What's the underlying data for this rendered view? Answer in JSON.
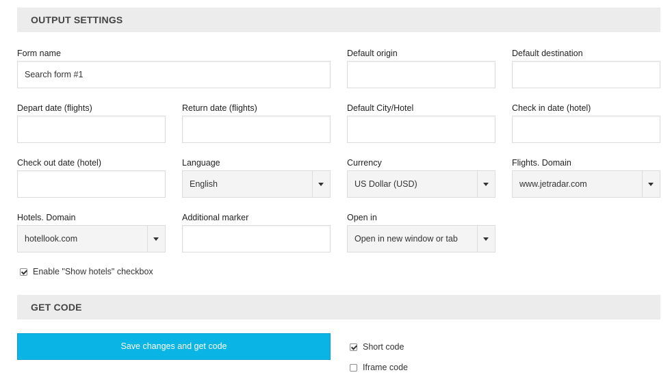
{
  "sections": {
    "output_settings": "OUTPUT SETTINGS",
    "get_code": "GET CODE"
  },
  "fields": {
    "form_name": {
      "label": "Form name",
      "value": "Search form #1"
    },
    "default_origin": {
      "label": "Default origin",
      "value": ""
    },
    "default_destination": {
      "label": "Default destination",
      "value": ""
    },
    "depart_date": {
      "label": "Depart date (flights)",
      "value": ""
    },
    "return_date": {
      "label": "Return date (flights)",
      "value": ""
    },
    "default_city_hotel": {
      "label": "Default City/Hotel",
      "value": ""
    },
    "check_in_date": {
      "label": "Check in date (hotel)",
      "value": ""
    },
    "check_out_date": {
      "label": "Check out date (hotel)",
      "value": ""
    },
    "language": {
      "label": "Language",
      "value": "English"
    },
    "currency": {
      "label": "Currency",
      "value": "US Dollar (USD)"
    },
    "flights_domain": {
      "label": "Flights. Domain",
      "value": "www.jetradar.com"
    },
    "hotels_domain": {
      "label": "Hotels. Domain",
      "value": "hotellook.com"
    },
    "additional_marker": {
      "label": "Additional marker",
      "value": ""
    },
    "open_in": {
      "label": "Open in",
      "value": "Open in new window or tab"
    }
  },
  "checkboxes": {
    "show_hotels": {
      "label": "Enable \"Show hotels\" checkbox",
      "checked": true
    },
    "short_code": {
      "label": "Short code",
      "checked": true
    },
    "iframe_code": {
      "label": "Iframe code",
      "checked": false
    }
  },
  "buttons": {
    "save": "Save changes and get code"
  },
  "icons": {
    "dropdown": "chevron-down-icon",
    "check": "checkmark-icon"
  },
  "colors": {
    "accent": "#0ab4e4",
    "header_bg": "#ececec",
    "select_bg": "#f4f4f4"
  }
}
